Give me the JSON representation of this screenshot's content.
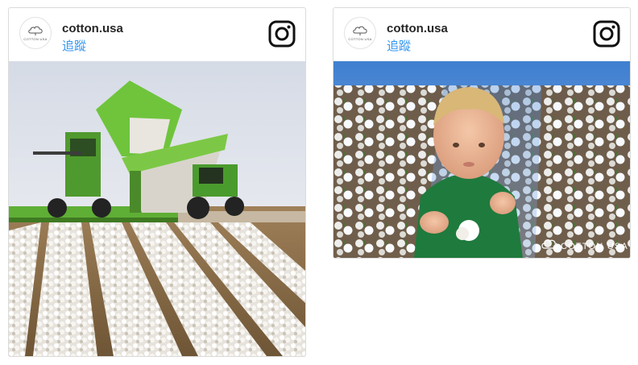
{
  "posts": [
    {
      "username": "cotton.usa",
      "follow_label": "追蹤",
      "avatar_brand": "COTTON USA",
      "image_alt": "Green cotton harvester and tractor in a field of white cotton rows"
    },
    {
      "username": "cotton.usa",
      "follow_label": "追蹤",
      "avatar_brand": "COTTON USA",
      "image_alt": "Baby in green shirt holding a cotton boll in a cotton field",
      "watermark": "COTTON USA"
    }
  ],
  "colors": {
    "follow_link": "#3897f0",
    "username": "#262626",
    "border": "#dbdbdb"
  },
  "icons": [
    "instagram-icon",
    "cotton-logo-icon"
  ]
}
